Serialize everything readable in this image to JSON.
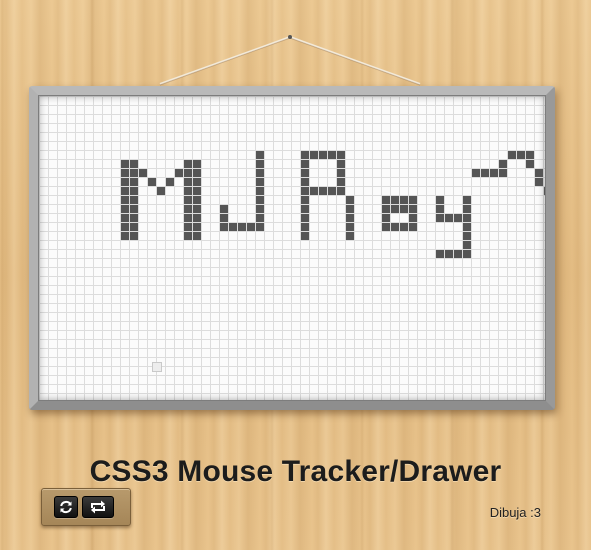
{
  "app": {
    "title": "CSS3 Mouse Tracker/Drawer",
    "status_text": "Dibuja :3"
  },
  "controls": {
    "buttons": [
      {
        "name": "refresh-button",
        "icon": "refresh-icon"
      },
      {
        "name": "repeat-button",
        "icon": "repeat-icon"
      }
    ]
  },
  "board": {
    "drawing_text": "MJ Ray~v",
    "drawing_color": "#555555",
    "grid_color": "#dcdcdc",
    "frame_color": "#a6a6a6"
  }
}
